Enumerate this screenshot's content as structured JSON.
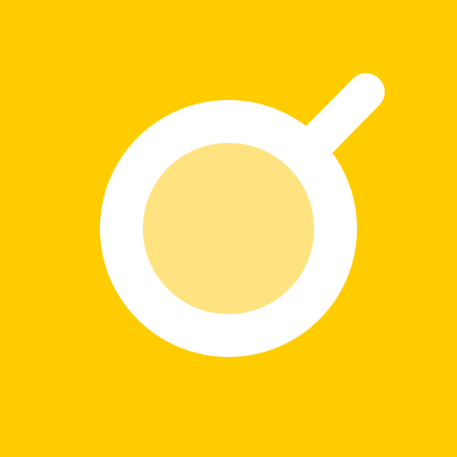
{
  "icon": {
    "name": "coffee-cup-top-view-icon",
    "colors": {
      "background": "#ffcc00",
      "cup": "#ffffff",
      "liquid": "#ffe380"
    }
  }
}
